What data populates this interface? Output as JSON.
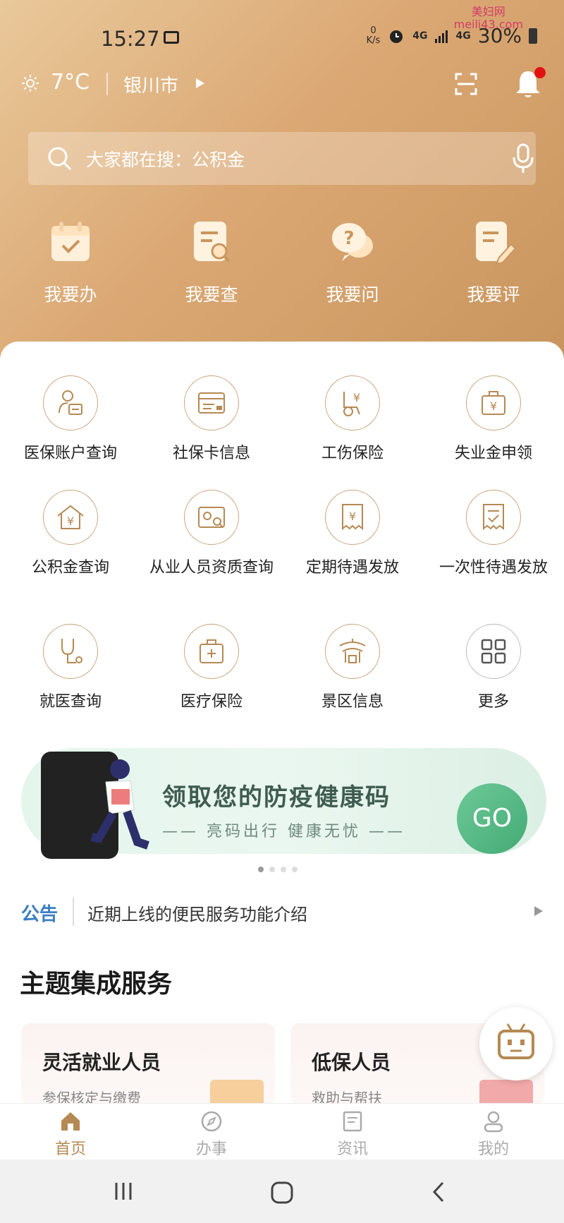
{
  "status": {
    "time": "15:27",
    "speed_top": "0",
    "speed_unit": "K/s",
    "net1": "4G",
    "net2": "4G",
    "battery": "30%"
  },
  "watermark": {
    "line1": "美妇网",
    "line2": "meili43.com"
  },
  "top": {
    "temperature": "7°C",
    "city": "银川市"
  },
  "search": {
    "placeholder": "大家都在搜：公积金"
  },
  "quick": [
    {
      "label": "我要办",
      "icon": "calendar-check-icon"
    },
    {
      "label": "我要查",
      "icon": "document-search-icon"
    },
    {
      "label": "我要问",
      "icon": "question-chat-icon"
    },
    {
      "label": "我要评",
      "icon": "document-edit-icon"
    }
  ],
  "services": [
    {
      "label": "医保账户查询",
      "icon": "medical-account-icon"
    },
    {
      "label": "社保卡信息",
      "icon": "social-security-card-icon"
    },
    {
      "label": "工伤保险",
      "icon": "wheelchair-yen-icon"
    },
    {
      "label": "失业金申领",
      "icon": "briefcase-yen-icon"
    },
    {
      "label": "公积金查询",
      "icon": "house-yen-icon"
    },
    {
      "label": "从业人员资质查询",
      "icon": "certificate-search-icon"
    },
    {
      "label": "定期待遇发放",
      "icon": "receipt-yen-icon"
    },
    {
      "label": "一次性待遇发放",
      "icon": "receipt-check-icon"
    },
    {
      "label": "就医查询",
      "icon": "stethoscope-icon"
    },
    {
      "label": "医疗保险",
      "icon": "medical-kit-icon"
    },
    {
      "label": "景区信息",
      "icon": "pavilion-icon"
    },
    {
      "label": "更多",
      "icon": "grid-more-icon"
    }
  ],
  "banner": {
    "title": "领取您的防疫健康码",
    "subtitle": "—— 亮码出行 健康无忧 ——",
    "go": "GO"
  },
  "notice": {
    "tag": "公告",
    "text": "近期上线的便民服务功能介绍"
  },
  "section_title": "主题集成服务",
  "cards": [
    {
      "title": "灵活就业人员",
      "subtitle": "参保核定与缴费"
    },
    {
      "title": "低保人员",
      "subtitle": "救助与帮扶"
    }
  ],
  "tabs": [
    {
      "label": "首页",
      "icon": "home-icon"
    },
    {
      "label": "办事",
      "icon": "compass-icon"
    },
    {
      "label": "资讯",
      "icon": "news-icon"
    },
    {
      "label": "我的",
      "icon": "user-icon"
    }
  ],
  "colors": {
    "accent": "#b58953",
    "hero": "#dba874",
    "notice_blue": "#3b7fc0",
    "go_green": "#4fb47f"
  }
}
